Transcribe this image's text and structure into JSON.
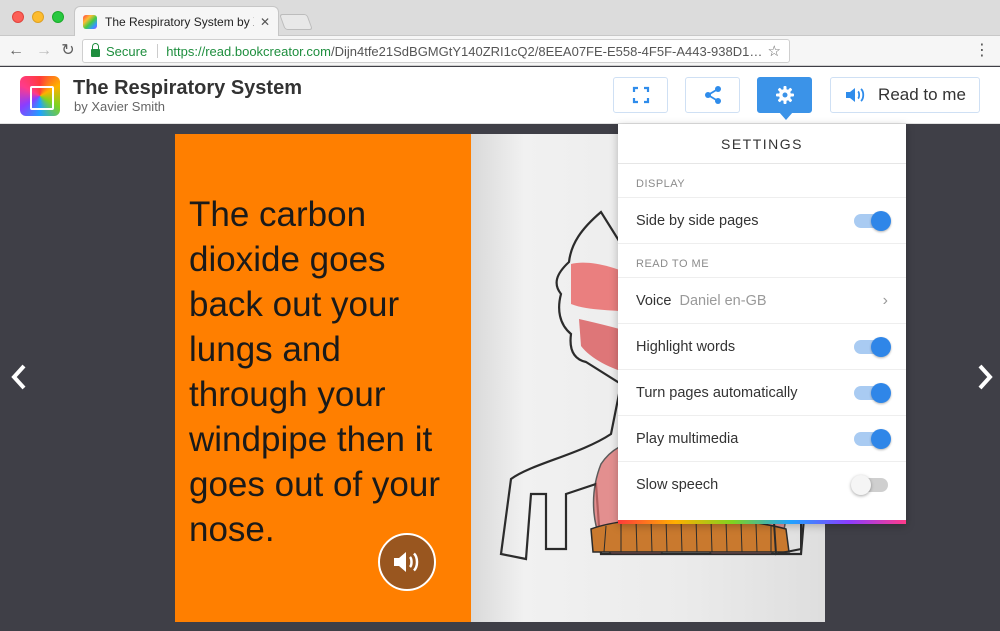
{
  "browser": {
    "tab_title": "The Respiratory System by Xa",
    "tab_close": "✕",
    "secure_label": "Secure",
    "url_host": "https://read.bookcreator.com",
    "url_path": "/Dijn4tfe21SdBGMGtY140ZRI1cQ2/8EEA07FE-E558-4F5F-A443-938D1…"
  },
  "header": {
    "book_title": "The Respiratory System",
    "author": "by Xavier Smith",
    "read_to_me_label": "Read to me",
    "accent_color": "#3b93e8"
  },
  "page": {
    "text": "The carbon dioxide goes back out your lungs and through your windpipe then it goes out of your nose.",
    "background_color": "#ff7f00"
  },
  "settings": {
    "title": "SETTINGS",
    "display_section": "DISPLAY",
    "side_by_side_label": "Side by side pages",
    "read_section": "READ TO ME",
    "voice_label": "Voice",
    "voice_value": "Daniel en-GB",
    "highlight_label": "Highlight words",
    "turn_pages_label": "Turn pages automatically",
    "multimedia_label": "Play multimedia",
    "slow_speech_label": "Slow speech"
  },
  "icons": [
    "fullscreen-icon",
    "share-icon",
    "gear-icon",
    "speaker-icon",
    "chevron-left-icon",
    "chevron-right-icon"
  ]
}
